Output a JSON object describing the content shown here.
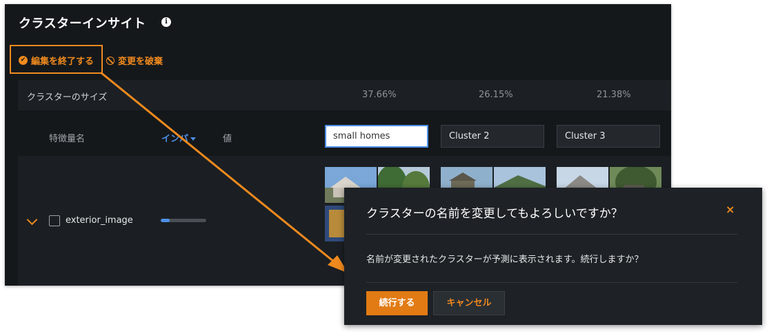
{
  "panel": {
    "title": "クラスターインサイト",
    "info_icon": "i",
    "finish_edit_label": "編集を終了する",
    "discard_label": "変更を破棄",
    "cluster_size_label": "クラスターのサイズ",
    "cluster_sizes": [
      "37.66%",
      "26.15%",
      "21.38%"
    ],
    "headers": {
      "feature_name": "特徴量名",
      "impact": "インパ",
      "value": "値"
    },
    "cluster_names": [
      "small homes",
      "Cluster 2",
      "Cluster 3"
    ],
    "feature": {
      "name": "exterior_image",
      "impact_fraction": 0.2
    }
  },
  "dialog": {
    "title": "クラスターの名前を変更してもよろしいですか？",
    "close_icon": "×",
    "message": "名前が変更されたクラスターが予測に表示されます。続行しますか？",
    "confirm_label": "続行する",
    "cancel_label": "キャンセル"
  },
  "colors": {
    "accent": "#f08a1e",
    "link": "#4d8fe8",
    "panel_bg": "#15181b"
  }
}
